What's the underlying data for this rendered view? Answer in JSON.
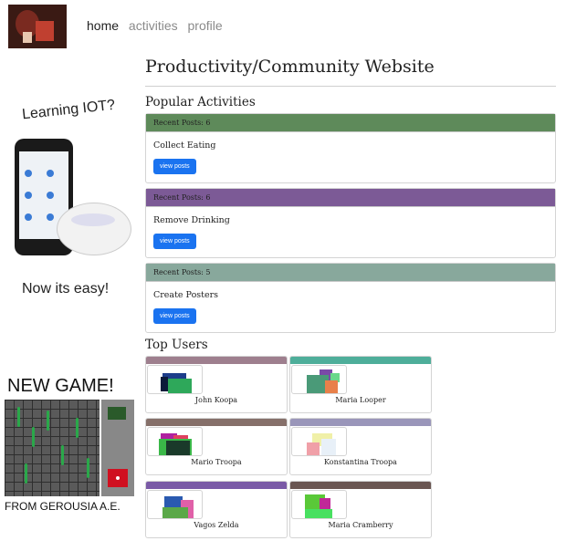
{
  "nav": {
    "items": [
      {
        "label": "home",
        "active": true
      },
      {
        "label": "activities",
        "active": false
      },
      {
        "label": "profile",
        "active": false
      }
    ]
  },
  "ads": {
    "iot": {
      "title": "Learning IOT?",
      "tagline": "Now its easy!"
    },
    "game": {
      "title": "NEW GAME!",
      "tagline": "FROM GEROUSIA A.E."
    }
  },
  "page": {
    "title": "Productivity/Community Website",
    "popular_heading": "Popular Activities",
    "top_users_heading": "Top Users"
  },
  "activities": [
    {
      "posts": "Recent Posts: 6",
      "name": "Collect Eating",
      "button": "view posts",
      "color": "#5e8a5a"
    },
    {
      "posts": "Recent Posts: 6",
      "name": "Remove Drinking",
      "button": "view posts",
      "color": "#7c5a96"
    },
    {
      "posts": "Recent Posts: 5",
      "name": "Create Posters",
      "button": "view posts",
      "color": "#88a89c"
    }
  ],
  "users": [
    {
      "name": "John Koopa",
      "color": "#9e7f8e"
    },
    {
      "name": "Maria Looper",
      "color": "#4eae9a"
    },
    {
      "name": "Mario Troopa",
      "color": "#86706a"
    },
    {
      "name": "Konstantina Troopa",
      "color": "#9a96ba"
    },
    {
      "name": "Vagos Zelda",
      "color": "#7a5aa6"
    },
    {
      "name": "Maria Cramberry",
      "color": "#6a5652"
    }
  ]
}
